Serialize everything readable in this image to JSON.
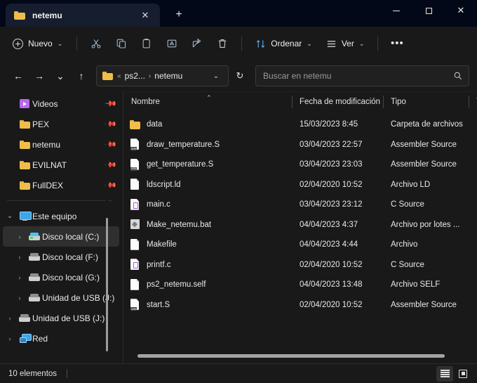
{
  "window": {
    "tab_title": "netemu",
    "tab_close_label": "✕",
    "new_tab_label": "+",
    "minimize_label": "",
    "maximize_label": "",
    "close_label": "✕"
  },
  "toolbar": {
    "new_label": "Nuevo",
    "new_chevron": "⌄",
    "cut_icon": "scissors-icon",
    "copy_icon": "copy-icon",
    "paste_icon": "paste-icon",
    "rename_icon": "rename-icon",
    "share_icon": "share-icon",
    "delete_icon": "trash-icon",
    "sort_label": "Ordenar",
    "sort_chevron": "⌄",
    "view_label": "Ver",
    "view_chevron": "⌄",
    "more_label": "•••"
  },
  "addressbar": {
    "back_label": "←",
    "forward_label": "→",
    "recent_label": "⌄",
    "up_label": "↑",
    "path_prefix": "«",
    "crumb_1": "ps2...",
    "crumb_sep": "›",
    "crumb_2": "netemu",
    "path_chevron": "⌄",
    "refresh_label": "↻",
    "search_placeholder": "Buscar en netemu",
    "search_value": "",
    "search_icon": "search-icon"
  },
  "sidebar": {
    "quick_items": [
      {
        "label": "Videos",
        "icon": "videos-icon",
        "pinned": true
      },
      {
        "label": "PEX",
        "icon": "folder-icon",
        "pinned": true
      },
      {
        "label": "netemu",
        "icon": "folder-icon",
        "pinned": true
      },
      {
        "label": "EVILNAT",
        "icon": "folder-icon",
        "pinned": true
      },
      {
        "label": "FullDEX",
        "icon": "folder-icon",
        "pinned": true
      }
    ],
    "tree_items": [
      {
        "label": "Este equipo",
        "icon": "this-pc-icon",
        "arrow": "⌄",
        "expanded": true,
        "indent": 0,
        "selected": false
      },
      {
        "label": "Disco local (C:)",
        "icon": "drive-c-icon",
        "arrow": "›",
        "expanded": false,
        "indent": 1,
        "selected": true
      },
      {
        "label": "Disco local (F:)",
        "icon": "drive-icon",
        "arrow": "›",
        "expanded": false,
        "indent": 1,
        "selected": false
      },
      {
        "label": "Disco local (G:)",
        "icon": "drive-icon",
        "arrow": "›",
        "expanded": false,
        "indent": 1,
        "selected": false
      },
      {
        "label": "Unidad de USB (J:)",
        "icon": "usb-drive-icon",
        "arrow": "›",
        "expanded": false,
        "indent": 1,
        "selected": false
      },
      {
        "label": "Unidad de USB (J:)",
        "icon": "usb-drive-icon",
        "arrow": "›",
        "expanded": false,
        "indent": 0,
        "selected": false
      },
      {
        "label": "Red",
        "icon": "network-icon",
        "arrow": "›",
        "expanded": false,
        "indent": 0,
        "selected": false
      }
    ],
    "pin_glyph": "📌"
  },
  "filelist": {
    "columns": {
      "name": "Nombre",
      "date": "Fecha de modificación",
      "type": "Tipo",
      "size": "Tam"
    },
    "sort_caret": "⌃",
    "rows": [
      {
        "name": "data",
        "date": "15/03/2023 8:45",
        "type": "Carpeta de archivos",
        "icon": "folder-icon"
      },
      {
        "name": "draw_temperature.S",
        "date": "03/04/2023 22:57",
        "type": "Assembler Source",
        "icon": "assembler-file-icon"
      },
      {
        "name": "get_temperature.S",
        "date": "03/04/2023 23:03",
        "type": "Assembler Source",
        "icon": "assembler-file-icon"
      },
      {
        "name": "ldscript.ld",
        "date": "02/04/2020 10:52",
        "type": "Archivo LD",
        "icon": "generic-file-icon"
      },
      {
        "name": "main.c",
        "date": "03/04/2023 23:12",
        "type": "C Source",
        "icon": "c-source-file-icon"
      },
      {
        "name": "Make_netemu.bat",
        "date": "04/04/2023 4:37",
        "type": "Archivo por lotes ...",
        "icon": "batch-file-icon"
      },
      {
        "name": "Makefile",
        "date": "04/04/2023 4:44",
        "type": "Archivo",
        "icon": "generic-file-icon"
      },
      {
        "name": "printf.c",
        "date": "02/04/2020 10:52",
        "type": "C Source",
        "icon": "c-source-file-icon"
      },
      {
        "name": "ps2_netemu.self",
        "date": "04/04/2023 13:48",
        "type": "Archivo SELF",
        "icon": "generic-file-icon"
      },
      {
        "name": "start.S",
        "date": "02/04/2020 10:52",
        "type": "Assembler Source",
        "icon": "assembler-file-icon"
      }
    ]
  },
  "statusbar": {
    "item_count": "10 elementos",
    "details_view_icon": "details-view-icon",
    "large_icons_view_icon": "large-icons-view-icon"
  },
  "colors": {
    "titlebar": "#020817",
    "tab_active": "#161d2e",
    "app_bg": "#191919",
    "selection": "#2f2f2f",
    "folder_yellow": "#f0bd4a",
    "accent_blue": "#3da5e8"
  }
}
